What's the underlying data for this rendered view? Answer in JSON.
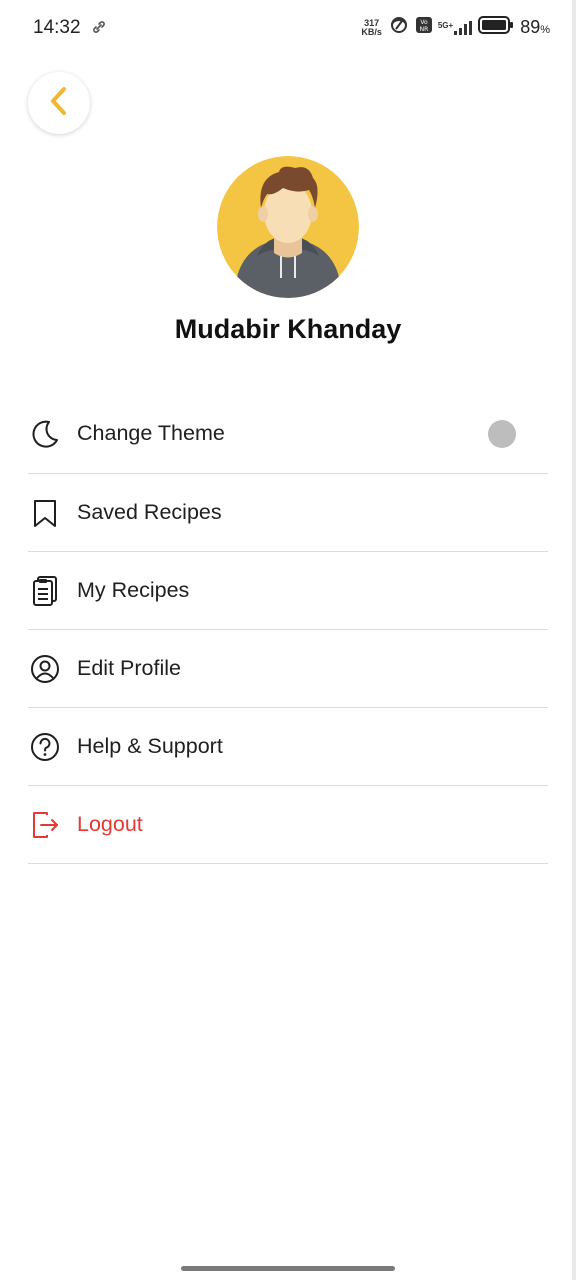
{
  "status_bar": {
    "time": "14:32",
    "speed_value": "317",
    "speed_unit": "KB/s",
    "network": "5G+",
    "battery_percent": "89",
    "battery_unit": "%"
  },
  "profile": {
    "name": "Mudabir Khanday"
  },
  "colors": {
    "accent": "#F2B632",
    "avatar_bg": "#F4C542",
    "logout": "#E53935"
  },
  "menu": {
    "items": [
      {
        "label": "Change Theme",
        "icon": "moon-icon"
      },
      {
        "label": "Saved Recipes",
        "icon": "bookmark-icon"
      },
      {
        "label": "My Recipes",
        "icon": "clipboard-icon"
      },
      {
        "label": "Edit Profile",
        "icon": "user-circle-icon"
      },
      {
        "label": "Help & Support",
        "icon": "help-circle-icon"
      },
      {
        "label": "Logout",
        "icon": "logout-icon"
      }
    ],
    "theme_toggle_on": false
  }
}
